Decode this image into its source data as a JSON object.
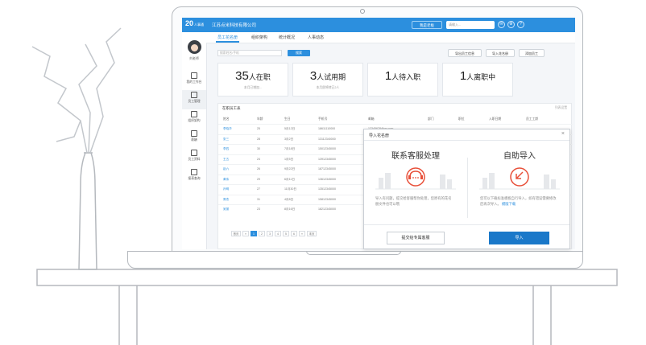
{
  "app": {
    "logo": "20",
    "logo_sub": "人事通",
    "company": "江苏点米科技有限公司",
    "top_button": "我是老板",
    "search_placeholder": "请输入..."
  },
  "sidebar": {
    "user_name": "刘老师",
    "items": [
      {
        "label": "我的工作台"
      },
      {
        "label": "员工管理"
      },
      {
        "label": "组织架构"
      },
      {
        "label": "薪酬"
      },
      {
        "label": "员工资料"
      },
      {
        "label": "报表查询"
      }
    ]
  },
  "tabs": [
    {
      "label": "员工花名册"
    },
    {
      "label": "组织架构"
    },
    {
      "label": "统计概况"
    },
    {
      "label": "人事动态"
    }
  ],
  "toolbar": {
    "search_placeholder": "搜索姓名/手机",
    "search_button": "搜索",
    "export_button": "导出员工信息",
    "import_button": "导入花名册",
    "add_button": "添加员工"
  },
  "stats": [
    {
      "count": "35",
      "unit": "人在职",
      "sub": "本月已增加..."
    },
    {
      "count": "3",
      "unit": "人试用期",
      "sub": "本月即将转正2人"
    },
    {
      "count": "1",
      "unit": "人待入职",
      "sub": ""
    },
    {
      "count": "1",
      "unit": "人离职中",
      "sub": ""
    }
  ],
  "table": {
    "title": "在职员工表",
    "right_link": "列表设置",
    "headers": [
      "姓名",
      "年龄",
      "生日",
      "手机号",
      "邮箱",
      "部门",
      "职位",
      "入职日期",
      "员工工龄"
    ],
    "rows": [
      {
        "name": "李晓华",
        "age": "25",
        "birth": "5月12日",
        "phone": "18611110000",
        "email": "12345678@qq.com"
      },
      {
        "name": "张三",
        "age": "28",
        "birth": "3月2日",
        "phone": "13112340000",
        "email": "12345678@qq.com"
      },
      {
        "name": "李四",
        "age": "30",
        "birth": "7月18日",
        "phone": "15012345000",
        "email": "12345678@qq.com"
      },
      {
        "name": "王五",
        "age": "24",
        "birth": "1月5日",
        "phone": "13912345000",
        "email": "12345678@qq.com"
      },
      {
        "name": "赵六",
        "age": "26",
        "birth": "9月22日",
        "phone": "18712345000",
        "email": "12345678@qq.com"
      },
      {
        "name": "黄伟",
        "age": "29",
        "birth": "6月11日",
        "phone": "13612345000",
        "email": "12345678@qq.com"
      },
      {
        "name": "孙明",
        "age": "27",
        "birth": "11月30日",
        "phone": "13512345000",
        "email": "12345678@qq.com"
      },
      {
        "name": "周杰",
        "age": "31",
        "birth": "4月8日",
        "phone": "15812345000",
        "email": "12345678@qq.com"
      },
      {
        "name": "吴丽",
        "age": "23",
        "birth": "8月16日",
        "phone": "18212345000",
        "email": "12345678@qq.com"
      }
    ],
    "pager": [
      "首页",
      "«",
      "1",
      "2",
      "3",
      "4",
      "5",
      "6",
      "»",
      "末页"
    ]
  },
  "dialog": {
    "title": "导入花名册",
    "close": "×",
    "option_left_title": "联系客服处理",
    "option_left_desc": "导入有问题，提交给客服帮你处理，您原有的花名册文件也可以哦",
    "option_right_title": "自助导入",
    "option_right_desc": "您可以下载标准模板自行导入，如有错误需要修改后再次导入。",
    "option_right_link": "模版下载",
    "button_contact": "提交给专属客服",
    "button_import": "导入"
  },
  "colors": {
    "brand": "#2c8fde",
    "primary_button": "#1a78c9",
    "icon_accent": "#e8503a"
  }
}
